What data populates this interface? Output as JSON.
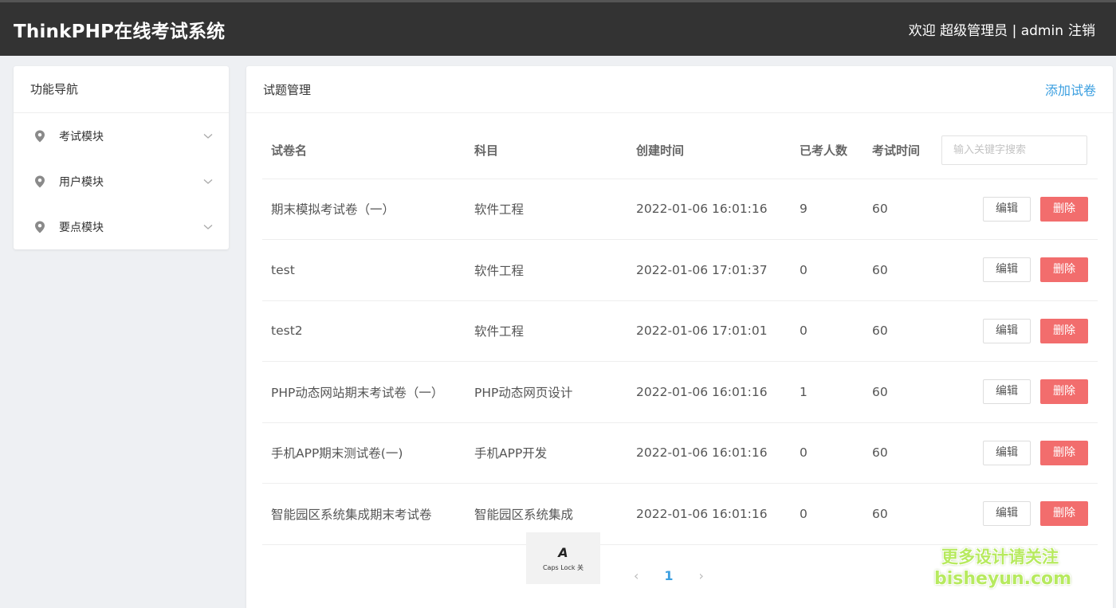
{
  "header": {
    "app_title": "ThinkPHP在线考试系统",
    "welcome": "欢迎 超级管理员 | admin",
    "logout": "注销"
  },
  "sidebar": {
    "title": "功能导航",
    "items": [
      {
        "label": "考试模块",
        "icon": "map-pin-icon"
      },
      {
        "label": "用户模块",
        "icon": "map-pin-icon"
      },
      {
        "label": "要点模块",
        "icon": "map-pin-icon"
      }
    ]
  },
  "main": {
    "title": "试题管理",
    "add_label": "添加试卷",
    "search_placeholder": "输入关键字搜索",
    "columns": [
      "试卷名",
      "科目",
      "创建时间",
      "已考人数",
      "考试时间"
    ],
    "edit_label": "编辑",
    "delete_label": "删除",
    "rows": [
      {
        "name": "期末模拟考试卷（一）",
        "subject": "软件工程",
        "created": "2022-01-06 16:01:16",
        "taken": "9",
        "duration": "60"
      },
      {
        "name": "test",
        "subject": "软件工程",
        "created": "2022-01-06 17:01:37",
        "taken": "0",
        "duration": "60"
      },
      {
        "name": "test2",
        "subject": "软件工程",
        "created": "2022-01-06 17:01:01",
        "taken": "0",
        "duration": "60"
      },
      {
        "name": "PHP动态网站期末考试卷（一）",
        "subject": "PHP动态网页设计",
        "created": "2022-01-06 16:01:16",
        "taken": "1",
        "duration": "60"
      },
      {
        "name": "手机APP期末测试卷(一)",
        "subject": "手机APP开发",
        "created": "2022-01-06 16:01:16",
        "taken": "0",
        "duration": "60"
      },
      {
        "name": "智能园区系统集成期末考试卷",
        "subject": "智能园区系统集成",
        "created": "2022-01-06 16:01:16",
        "taken": "0",
        "duration": "60"
      }
    ]
  },
  "pagination": {
    "prev": "‹",
    "current": "1",
    "next": "›"
  },
  "caps_lock": {
    "glyph": "A",
    "text": "Caps Lock 关"
  },
  "watermark": {
    "line1": "更多设计请关注",
    "line2": "bisheyun.com"
  },
  "colors": {
    "accent": "#3b9fe0",
    "danger": "#f26d6d",
    "topbar": "#333333"
  }
}
